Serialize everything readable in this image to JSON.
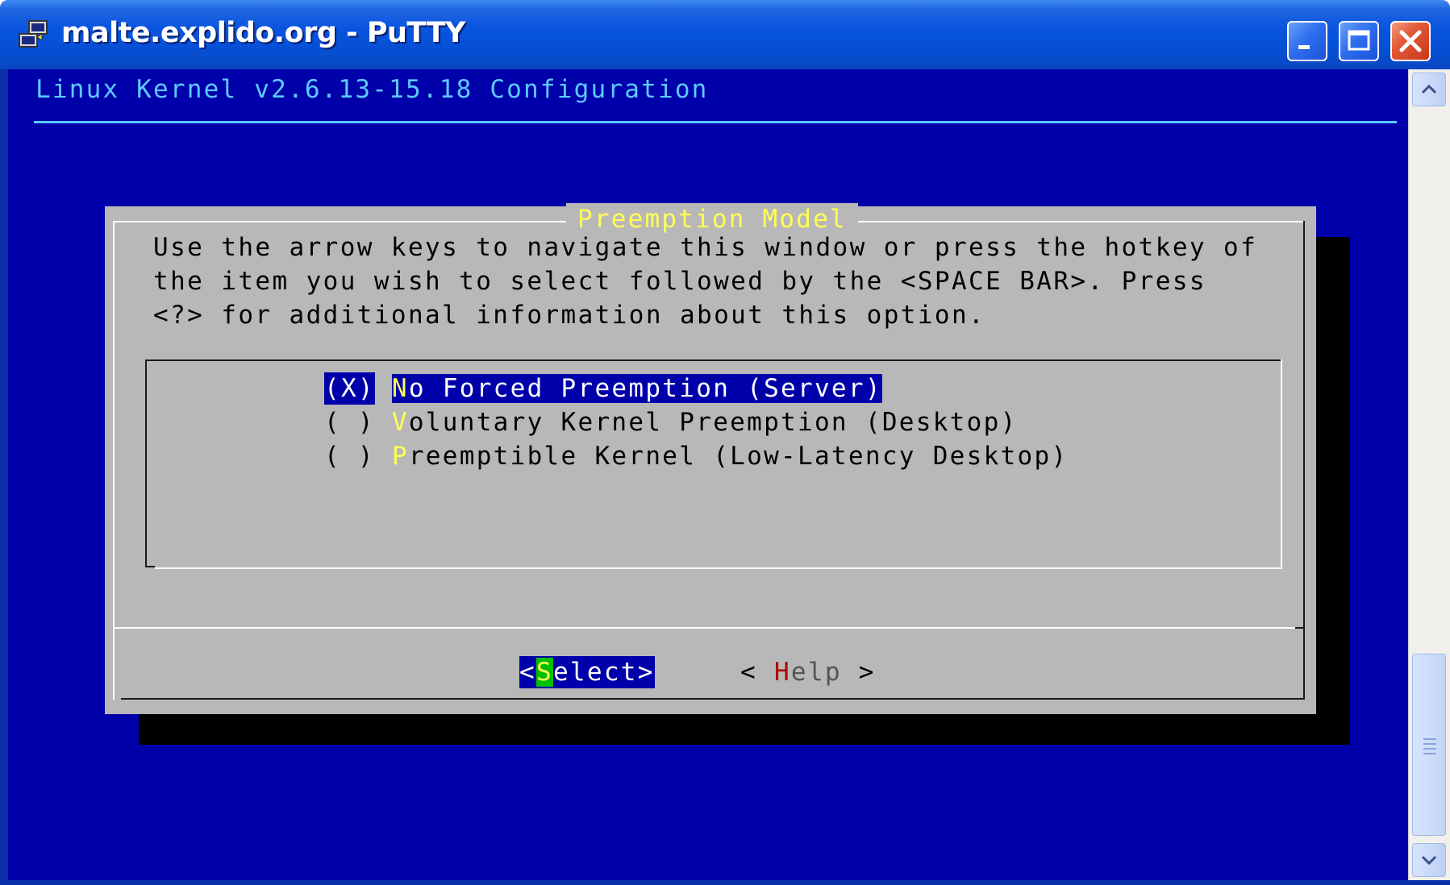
{
  "window": {
    "title": "malte.explido.org - PuTTY",
    "controls": [
      "minimize",
      "maximize",
      "close"
    ]
  },
  "terminal": {
    "header": "Linux Kernel v2.6.13-15.18 Configuration",
    "dialog": {
      "title": "Preemption Model",
      "description": [
        "Use the arrow keys to navigate this window or press the hotkey of",
        "the item you wish to select followed by the <SPACE BAR>. Press",
        "<?> for additional information about this option."
      ],
      "options": [
        {
          "mark": "(X)",
          "hotkey": "N",
          "rest": "o Forced Preemption (Server)",
          "selected": true
        },
        {
          "mark": "( )",
          "hotkey": "V",
          "rest": "oluntary Kernel Preemption (Desktop)",
          "selected": false
        },
        {
          "mark": "( )",
          "hotkey": "P",
          "rest": "reemptible Kernel (Low-Latency Desktop)",
          "selected": false
        }
      ],
      "buttons": {
        "select": {
          "prefix": "<",
          "hotkey": "S",
          "rest": "elect>"
        },
        "help": {
          "prefix": "< ",
          "hotkey": "H",
          "rest": "elp",
          "suffix": " >"
        }
      }
    }
  },
  "colors": {
    "terminal_bg": "#0000aa",
    "header_fg": "#5cc9ff",
    "dialog_bg": "#b8b8b8",
    "hotkey": "#ffff55",
    "titlebar": "#0650d6"
  }
}
